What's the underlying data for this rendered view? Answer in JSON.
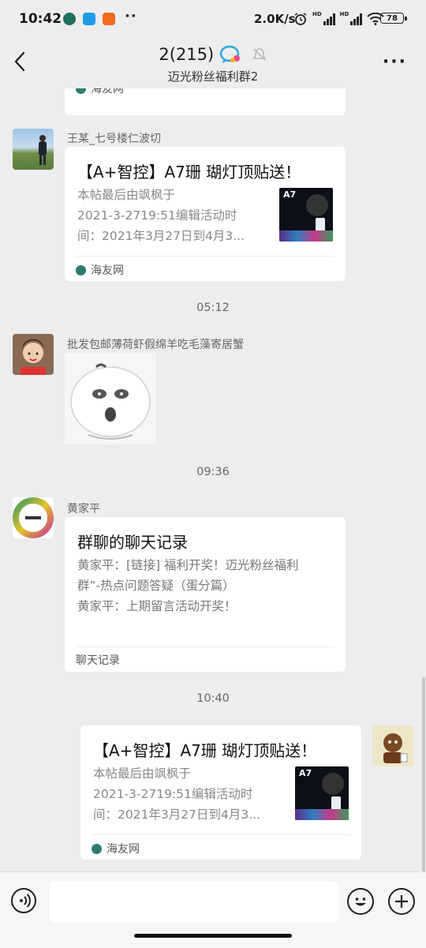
{
  "status_bar": {
    "time": "10:42",
    "more_dots": "··",
    "net_speed": "2.0K/s",
    "hd1": "HD",
    "hd2": "HD",
    "battery": "78"
  },
  "header": {
    "title": "2(215)",
    "subtitle": "迈光粉丝福利群2",
    "more": "···"
  },
  "messages": [
    {
      "type": "card_partial",
      "source": "海友网"
    },
    {
      "type": "link_card",
      "sender": "王某_七号楼仁波切",
      "title": "【A+智控】A7珊 瑚灯顶贴送！",
      "desc_lines": [
        "本帖最后由飒枫于",
        "2021-3-2719:51编辑活动时",
        "间：2021年3月27日到4月3..."
      ],
      "source": "海友网",
      "thumb_label": "A7"
    },
    {
      "type": "time",
      "text": "05:12"
    },
    {
      "type": "sticker",
      "sender": "批发包邮薄荷虾假绵羊吃毛藻寄居蟹"
    },
    {
      "type": "time",
      "text": "09:36"
    },
    {
      "type": "chat_record",
      "sender": "黄家平",
      "title": "群聊的聊天记录",
      "lines": [
        "黄家平：[链接] 福利开奖！迈光粉丝福利",
        "群”-热点问题答疑（蛋分篇）",
        "黄家平：上期留言活动开奖！"
      ],
      "footer": "聊天记录"
    },
    {
      "type": "time",
      "text": "10:40"
    },
    {
      "type": "link_card_self",
      "title": "【A+智控】A7珊 瑚灯顶贴送！",
      "desc_lines": [
        "本帖最后由飒枫于",
        "2021-3-2719:51编辑活动时",
        "间：2021年3月27日到4月3..."
      ],
      "source": "海友网",
      "thumb_label": "A7"
    }
  ],
  "input_bar": {
    "placeholder": ""
  },
  "icons": [
    "back-arrow-icon",
    "qq-badge-icon",
    "mute-bell-icon",
    "voice-icon",
    "emoji-icon",
    "plus-icon"
  ]
}
